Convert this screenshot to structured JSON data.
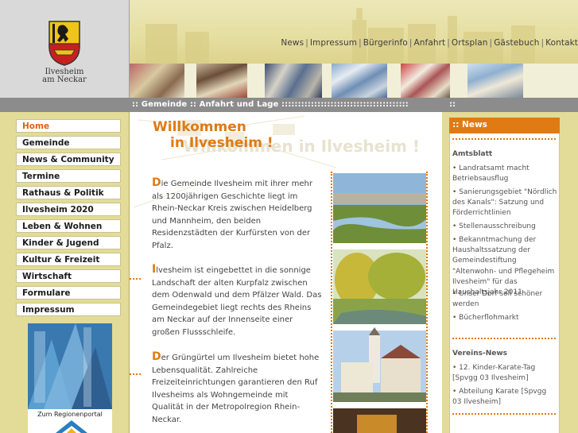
{
  "town": {
    "line1": "Ilvesheim",
    "line2": "am Neckar"
  },
  "top_nav": [
    "News",
    "Impressum",
    "Bürgerinfo",
    "Anfahrt",
    "Ortsplan",
    "Gästebuch",
    "Kontakt"
  ],
  "breadcrumb": {
    "text": ":: Gemeinde :: Anfahrt und Lage :::::::::::::::::::::::::::::::::::::::",
    "right": "::"
  },
  "sidebar": {
    "items": [
      {
        "label": "Home",
        "active": true
      },
      {
        "label": "Gemeinde"
      },
      {
        "label": "News & Community"
      },
      {
        "label": "Termine"
      },
      {
        "label": "Rathaus & Politik"
      },
      {
        "label": "Ilvesheim 2020"
      },
      {
        "label": "Leben & Wohnen"
      },
      {
        "label": "Kinder & Jugend"
      },
      {
        "label": "Kultur & Freizeit"
      },
      {
        "label": "Wirtschaft"
      },
      {
        "label": "Formulare"
      },
      {
        "label": "Impressum"
      }
    ],
    "region_label": "Zum Regionenportal"
  },
  "main": {
    "title_line1": "Willkommen",
    "title_line2": "in Ilvesheim !",
    "watermark": "Willkommen in Ilvesheim !",
    "paragraphs": [
      {
        "cap": "D",
        "text": "ie Gemeinde Ilvesheim mit ihrer mehr als 1200jährigen Geschichte liegt im Rhein-Neckar Kreis zwischen Heidelberg und Mannheim, den beiden Residenzstädten der Kurfürsten von der Pfalz."
      },
      {
        "cap": "I",
        "text": "lvesheim ist eingebettet in die sonnige Landschaft der alten Kurpfalz zwischen dem Odenwald und dem Pfälzer Wald. Das Gemeindegebiet liegt rechts des Rheins am Neckar auf der Innenseite einer großen Flussschleife."
      },
      {
        "cap": "D",
        "text": "er Grüngürtel um Ilvesheim bietet hohe Lebensqualität. Zahlreiche Freizeiteinrichtungen garantieren den Ruf Ilvesheims als Wohngemeinde mit Qualität in der Metropolregion Rhein-Neckar."
      }
    ]
  },
  "news": {
    "header": ":: News",
    "sections": [
      {
        "title": "Amtsblatt",
        "items": [
          "• Landratsamt macht Betriebsausflug",
          "• Sanierungsgebiet \"Nördlich des Kanals\": Satzung und Förderrichtlinien",
          "• Stellenausschreibung",
          "• Bekanntmachung der Haushaltssatzung der Gemeindestiftung \"Altenwohn- und Pflegeheim Ilvesheim\" für das Haushaltsjahr 2011",
          "• Unser Dorf soll schöner werden",
          "• Bücherflohmarkt"
        ]
      },
      {
        "title": "Vereins-News",
        "items": [
          "• 12. Kinder-Karate-Tag [Spvgg 03 Ilvesheim]",
          "• Abteilung Karate [Spvgg 03 Ilvesheim]"
        ]
      }
    ]
  },
  "colors": {
    "accent": "#e07a12",
    "sidebar_bg": "#e2dc98",
    "bar_grey": "#8c8c8c"
  }
}
